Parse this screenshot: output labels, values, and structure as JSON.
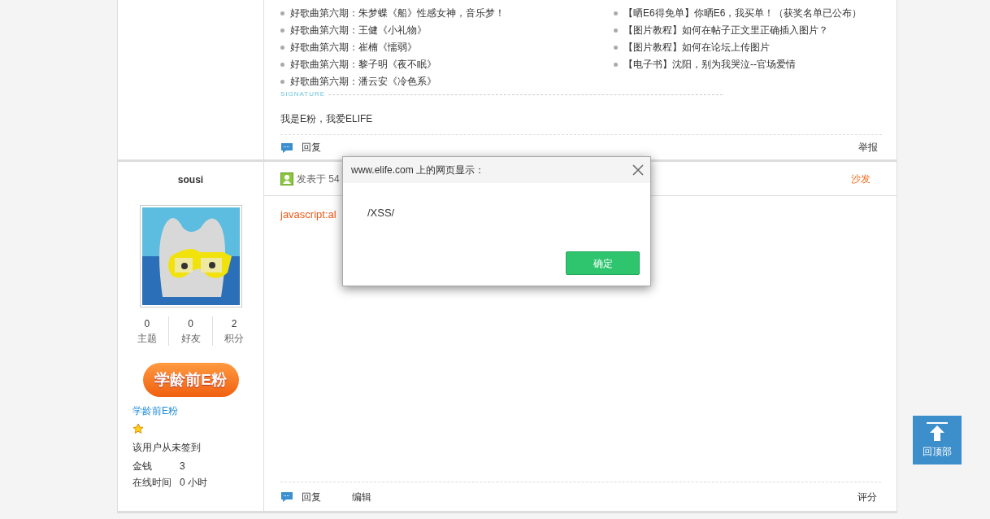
{
  "post_top": {
    "list_left": [
      "好歌曲第六期：朱梦蝶《船》性感女神，音乐梦！",
      "好歌曲第六期：王健《小礼物》",
      "好歌曲第六期：崔楠《懦弱》",
      "好歌曲第六期：黎子明《夜不眠》",
      "好歌曲第六期：潘云安《冷色系》"
    ],
    "list_right": [
      "【晒E6得免单】你晒E6，我买单！（获奖名单已公布）",
      "【图片教程】如何在帖子正文里正确插入图片？",
      "【图片教程】如何在论坛上传图片",
      "【电子书】沈阳，别为我哭泣--官场爱情"
    ],
    "signature_label": "SIGNATURE",
    "signature": "我是E粉，我爱ELIFE",
    "actions": [
      {
        "kind": "reply",
        "label": "回复"
      }
    ],
    "report": "举报"
  },
  "post": {
    "author": "sousi",
    "stats": [
      {
        "value": "0",
        "label": "主题"
      },
      {
        "value": "0",
        "label": "好友"
      },
      {
        "value": "2",
        "label": "积分"
      }
    ],
    "badge": "学龄前E粉",
    "rank": "学龄前E粉",
    "sign_status": "该用户从未签到",
    "details": [
      {
        "label": "金钱",
        "value": "3"
      },
      {
        "label": "在线时间",
        "value": "0 小时"
      }
    ],
    "posted": "发表于 54",
    "floor": "沙发",
    "content": "javascript:al",
    "actions": [
      {
        "kind": "reply",
        "label": "回复"
      },
      {
        "kind": "edit",
        "label": "编辑"
      }
    ],
    "rate": "评分"
  },
  "dialog": {
    "title": "www.elife.com 上的网页显示：",
    "message": "/XSS/",
    "ok": "确定"
  },
  "back_to_top": "回顶部"
}
